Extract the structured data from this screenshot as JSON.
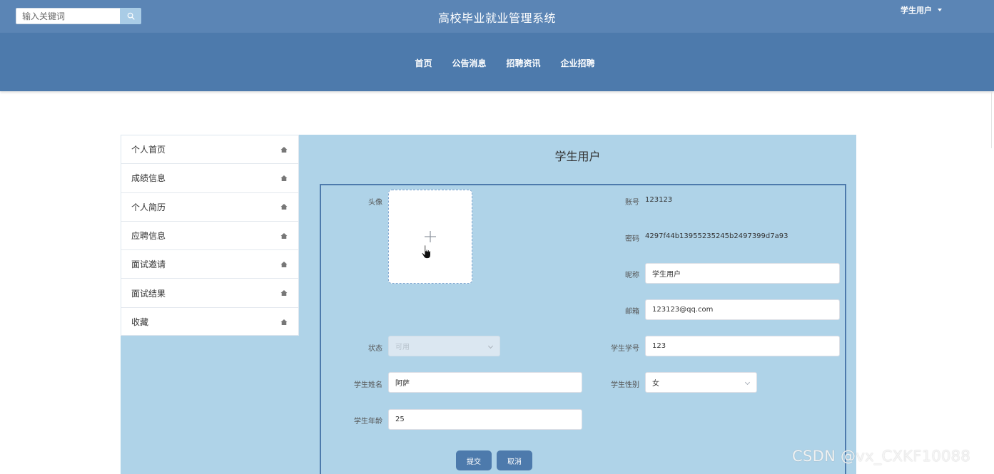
{
  "header": {
    "search_placeholder": "输入关键词",
    "search_icon": "search-icon",
    "title": "高校毕业就业管理系统",
    "user_label": "学生用户"
  },
  "nav": {
    "items": [
      {
        "label": "首页"
      },
      {
        "label": "公告消息"
      },
      {
        "label": "招聘资讯"
      },
      {
        "label": "企业招聘"
      }
    ]
  },
  "sidebar": {
    "items": [
      {
        "label": "个人首页",
        "icon": "home-icon"
      },
      {
        "label": "成绩信息",
        "icon": "home-icon"
      },
      {
        "label": "个人简历",
        "icon": "home-icon"
      },
      {
        "label": "应聘信息",
        "icon": "home-icon"
      },
      {
        "label": "面试邀请",
        "icon": "home-icon"
      },
      {
        "label": "面试结果",
        "icon": "home-icon"
      },
      {
        "label": "收藏",
        "icon": "home-icon"
      }
    ]
  },
  "main": {
    "heading": "学生用户",
    "form": {
      "avatar_label": "头像",
      "account_label": "账号",
      "account_value": "123123",
      "password_label": "密码",
      "password_value": "4297f44b13955235245b2497399d7a93",
      "nickname_label": "昵称",
      "nickname_value": "学生用户",
      "email_label": "邮箱",
      "email_value": "123123@qq.com",
      "status_label": "状态",
      "status_value": "可用",
      "student_no_label": "学生学号",
      "student_no_value": "123",
      "name_label": "学生姓名",
      "name_value": "阿萨",
      "gender_label": "学生性别",
      "gender_value": "女",
      "age_label": "学生年龄",
      "age_value": "25",
      "submit_label": "提交",
      "cancel_label": "取消"
    }
  },
  "watermark": "CSDN @vx_CXKF10088",
  "colors": {
    "topbar": "#5b85b5",
    "navbar": "#4d7aac",
    "content_bg": "#afd3e8",
    "button": "#4d7aac"
  }
}
